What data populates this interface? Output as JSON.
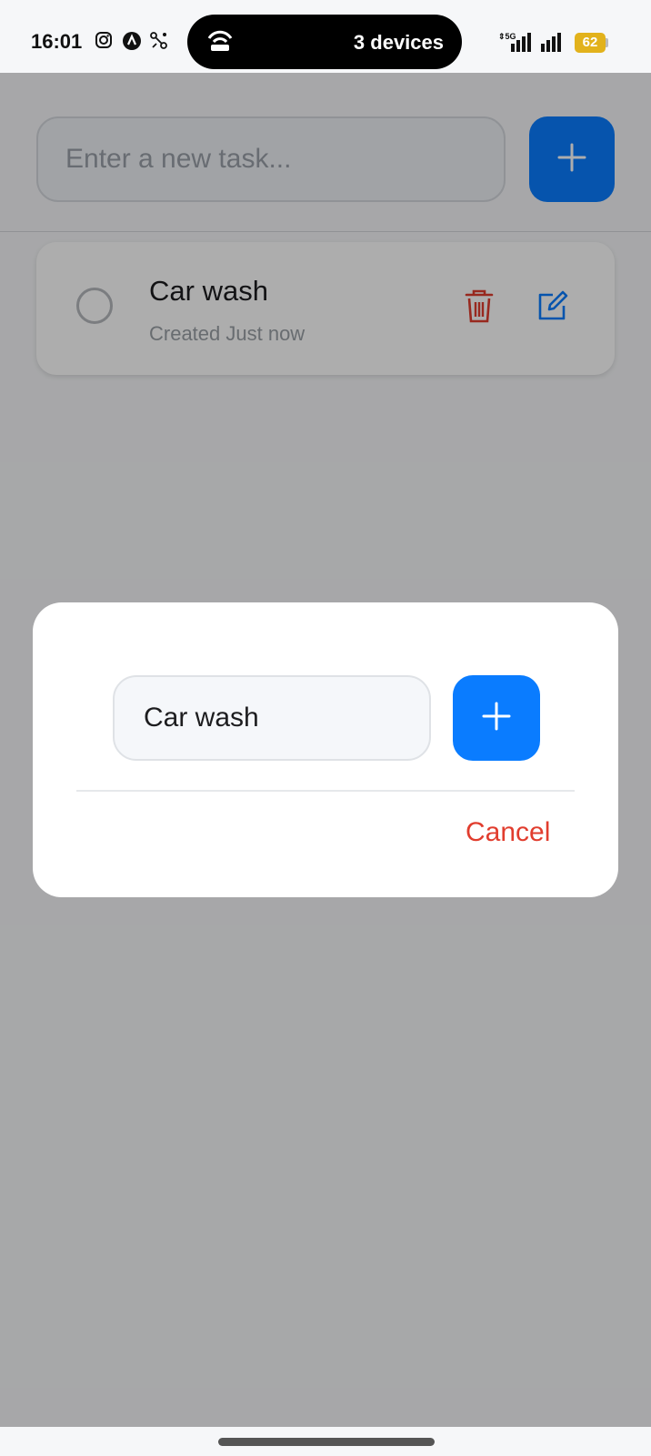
{
  "status_bar": {
    "time": "16:01",
    "island_text": "3 devices",
    "network": "5G",
    "battery": "62"
  },
  "header": {
    "new_task_placeholder": "Enter a new task...",
    "add_icon": "plus-icon"
  },
  "tasks": [
    {
      "title": "Car wash",
      "meta": "Created Just now",
      "delete_icon": "trash-icon",
      "edit_icon": "edit-icon"
    }
  ],
  "dialog": {
    "input_value": "Car wash",
    "cancel_label": "Cancel"
  },
  "colors": {
    "accent": "#0a7cff",
    "danger": "#e13d2e",
    "battery": "#e2b21c"
  }
}
